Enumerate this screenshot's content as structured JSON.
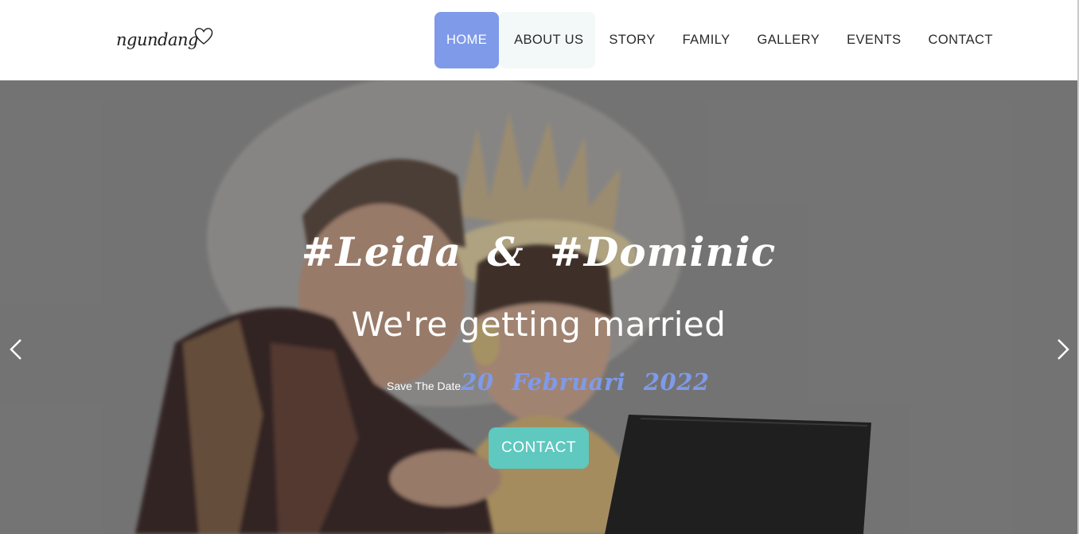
{
  "header": {
    "logo_text": "ngundang",
    "nav": [
      {
        "label": "HOME",
        "state": "active"
      },
      {
        "label": "ABOUT US",
        "state": "hover"
      },
      {
        "label": "STORY",
        "state": "normal"
      },
      {
        "label": "FAMILY",
        "state": "normal"
      },
      {
        "label": "GALLERY",
        "state": "normal"
      },
      {
        "label": "EVENTS",
        "state": "normal"
      },
      {
        "label": "CONTACT",
        "state": "normal"
      }
    ]
  },
  "hero": {
    "names": "#Leida & #Dominic",
    "subtitle": "We're getting married",
    "save_label": "Save The Date",
    "date": "20 Februari 2022",
    "cta_label": "CONTACT",
    "prev_icon": "chevron-left-icon",
    "next_icon": "chevron-right-icon"
  },
  "colors": {
    "accent": "#7f9ae9",
    "cta": "#5fc8bf",
    "hero_overlay": "#7b7b7b",
    "nav_text": "#2a2a2a"
  }
}
